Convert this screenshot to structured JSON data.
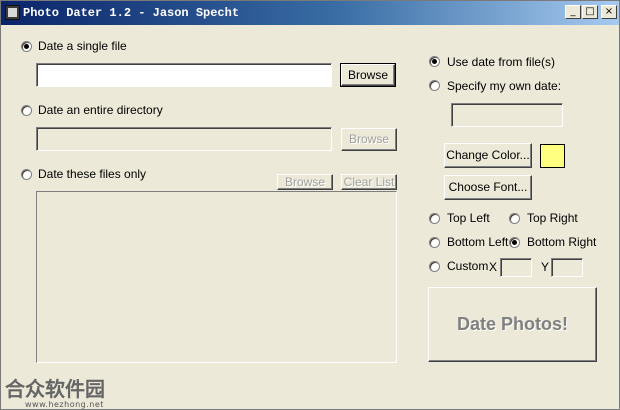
{
  "window": {
    "title": "Photo Dater 1.2 - Jason Specht",
    "controls": {
      "minimize": "_",
      "maximize": "□",
      "close": "×"
    }
  },
  "source": {
    "single_file": {
      "label": "Date a single file",
      "selected": true,
      "value": "",
      "browse_label": "Browse"
    },
    "directory": {
      "label": "Date an entire directory",
      "selected": false,
      "value": "",
      "browse_label": "Browse"
    },
    "files": {
      "label": "Date these files only",
      "selected": false,
      "browse_label": "Browse",
      "clear_label": "Clear List",
      "items": []
    }
  },
  "date_options": {
    "use_file_date_label": "Use date from file(s)",
    "use_file_date_selected": true,
    "own_date_label": "Specify my own date:",
    "own_date_value": ""
  },
  "appearance": {
    "change_color_label": "Change Color...",
    "color": "#ffff80",
    "choose_font_label": "Choose Font..."
  },
  "position": {
    "top_left": "Top Left",
    "top_right": "Top Right",
    "bottom_left": "Bottom Left",
    "bottom_right": "Bottom Right",
    "custom": "Custom",
    "x_label": "X",
    "y_label": "Y",
    "x_value": "",
    "y_value": "",
    "selected": "bottom_right"
  },
  "action": {
    "date_photos_label": "Date Photos!"
  },
  "watermark": {
    "text": "合众软件园",
    "url": "www.hezhong.net"
  }
}
